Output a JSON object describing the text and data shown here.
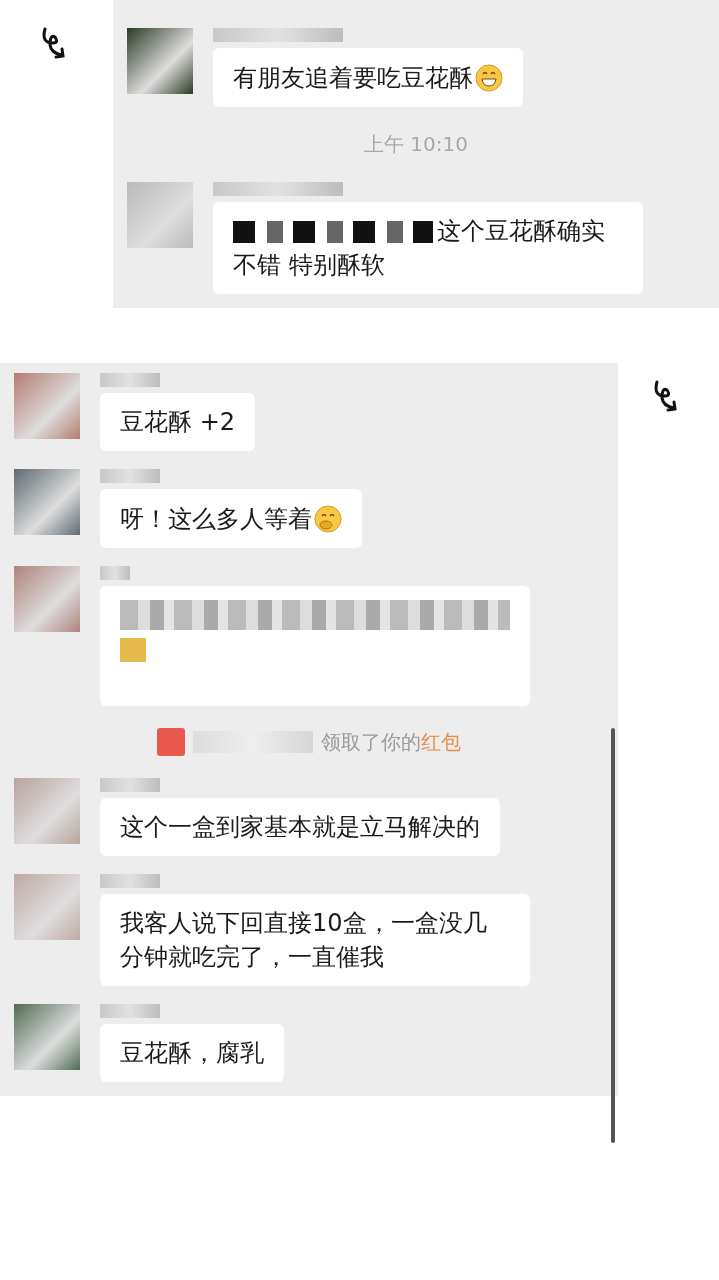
{
  "panels": [
    {
      "messages": [
        {
          "kind": "emoji_text",
          "text": "有朋友追着要吃豆花酥"
        },
        {
          "kind": "time",
          "text": "上午 10:10"
        },
        {
          "kind": "masked_text",
          "text": "这个豆花酥确实不错 特别酥软"
        }
      ]
    },
    {
      "messages": [
        {
          "kind": "text",
          "text": "豆花酥 +2"
        },
        {
          "kind": "emoji_text",
          "text": "呀！这么多人等着"
        },
        {
          "kind": "blurred"
        },
        {
          "kind": "notice",
          "text": "领取了你的",
          "highlight": "红包"
        },
        {
          "kind": "text",
          "text": "这个一盒到家基本就是立马解决的"
        },
        {
          "kind": "text",
          "text": "我客人说下回直接10盒，一盒没几分钟就吃完了，一直催我"
        },
        {
          "kind": "text",
          "text": "豆花酥，腐乳"
        }
      ]
    }
  ]
}
